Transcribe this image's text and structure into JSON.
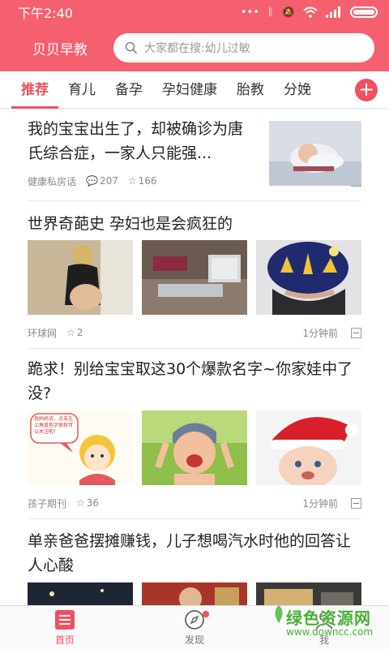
{
  "statusbar": {
    "time": "下午2:40",
    "icons": [
      "dots-icon",
      "bluetooth-icon",
      "mute-icon",
      "wifi-icon",
      "signal-icon",
      "battery-icon"
    ]
  },
  "topbar": {
    "brand": "贝贝早教",
    "search_placeholder": "大家都在搜:幼儿过敏"
  },
  "tabs": {
    "items": [
      "推荐",
      "育儿",
      "备孕",
      "孕妇健康",
      "胎教",
      "分娩"
    ],
    "active": "推荐",
    "add_label": "+"
  },
  "feed": [
    {
      "title": "我的宝宝出生了，却被确诊为唐氏综合症，一家人只能强...",
      "source": "健康私房话",
      "comments": "207",
      "stars": "166"
    },
    {
      "title": "世界奇葩史 孕妇也是会疯狂的",
      "source": "环球网",
      "stars": "2",
      "time": "1分钟前"
    },
    {
      "title": "跪求！别给宝宝取这30个爆款名字~你家娃中了没?",
      "source": "孩子期刊",
      "stars": "36",
      "time": "1分钟前",
      "cartoon_text": "我妈妈说，点击左上角蓝色字体就可以关注啦！"
    },
    {
      "title": "单亲爸爸摆摊赚钱，儿子想喝汽水时他的回答让人心酸"
    }
  ],
  "bottomnav": {
    "items": [
      "首页",
      "发现",
      "我"
    ],
    "active": "首页"
  },
  "watermark": {
    "line1": "绿色资源网",
    "line2": "www.downcc.com"
  },
  "colors": {
    "brand": "#f46070",
    "accent": "#f0505f",
    "watermark": "#46b035"
  }
}
